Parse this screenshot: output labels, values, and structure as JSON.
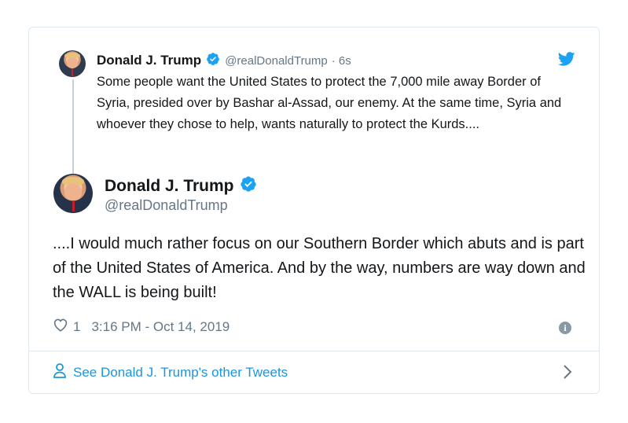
{
  "quoted": {
    "name": "Donald J. Trump",
    "handle": "@realDonaldTrump",
    "time": "· 6s",
    "text": "Some people want the United States to protect the 7,000 mile away Border of Syria, presided over by Bashar al-Assad, our enemy. At the same time, Syria and whoever they chose to help, wants naturally to protect the Kurds...."
  },
  "main": {
    "name": "Donald J. Trump",
    "handle": "@realDonaldTrump",
    "text": "....I would much rather focus on our Southern Border which abuts and is part of the United States of America. And by the way, numbers are way down and the WALL is being built!",
    "likes": "1",
    "timestamp": "3:16 PM - Oct 14, 2019"
  },
  "footer": {
    "link_text": "See Donald J. Trump's other Tweets"
  },
  "icons": {
    "verified": "verified-badge-icon",
    "brand": "bird-logo-icon",
    "like": "heart-icon",
    "info": "info-icon",
    "profile": "person-icon",
    "chevron": "chevron-right-icon"
  },
  "colors": {
    "accent": "#1b95e0",
    "text": "#14171a",
    "muted": "#657786",
    "border": "#e1e8ed"
  }
}
